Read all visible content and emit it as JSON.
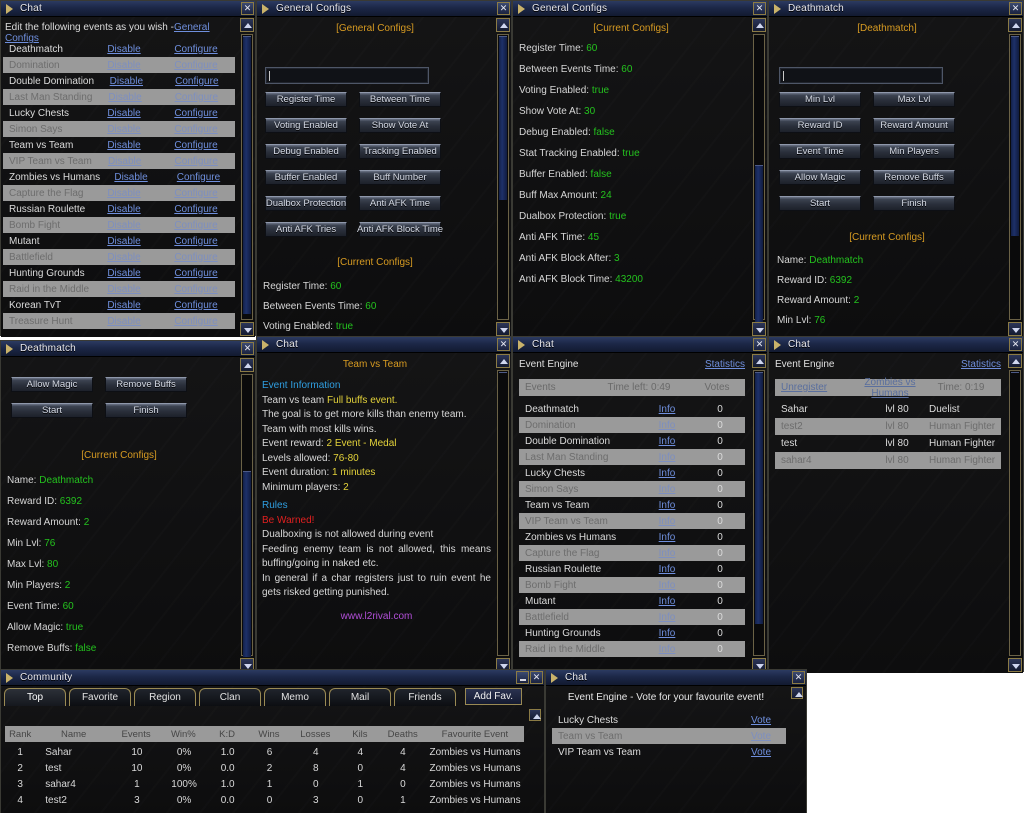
{
  "windows": {
    "events_list": {
      "title": "Chat",
      "intro_text": "Edit the following events as you wish -",
      "intro_link": "General Configs",
      "disable_label": "Disable",
      "configure_label": "Configure",
      "rows": [
        {
          "name": "Deathmatch"
        },
        {
          "name": "Domination"
        },
        {
          "name": "Double Domination"
        },
        {
          "name": "Last Man Standing"
        },
        {
          "name": "Lucky Chests"
        },
        {
          "name": "Simon Says"
        },
        {
          "name": "Team vs Team"
        },
        {
          "name": "VIP Team vs Team"
        },
        {
          "name": "Zombies vs Humans"
        },
        {
          "name": "Capture the Flag"
        },
        {
          "name": "Russian Roulette"
        },
        {
          "name": "Bomb Fight"
        },
        {
          "name": "Mutant"
        },
        {
          "name": "Battlefield"
        },
        {
          "name": "Hunting Grounds"
        },
        {
          "name": "Raid in the Middle"
        },
        {
          "name": "Korean TvT"
        },
        {
          "name": "Treasure Hunt"
        }
      ]
    },
    "general_configs": {
      "title": "General Configs",
      "heading": "[General Configs]",
      "input_value": "",
      "buttons": [
        "Register Time",
        "Between Time",
        "Voting Enabled",
        "Show Vote At",
        "Debug Enabled",
        "Tracking Enabled",
        "Buffer Enabled",
        "Buff Number",
        "Dualbox Protection",
        "Anti AFK Time",
        "Anti AFK Tries",
        "Anti AFK Block Time"
      ],
      "current_heading": "[Current Configs]",
      "current": [
        {
          "label": "Register Time:",
          "value": "60"
        },
        {
          "label": "Between Events Time:",
          "value": "60"
        },
        {
          "label": "Voting Enabled:",
          "value": "true"
        }
      ]
    },
    "general_configs_current": {
      "title": "General Configs",
      "heading": "[Current Configs]",
      "items": [
        {
          "label": "Register Time:",
          "value": "60"
        },
        {
          "label": "Between Events Time:",
          "value": "60"
        },
        {
          "label": "Voting Enabled:",
          "value": "true"
        },
        {
          "label": "Show Vote At:",
          "value": "30"
        },
        {
          "label": "Debug Enabled:",
          "value": "false"
        },
        {
          "label": "Stat Tracking Enabled:",
          "value": "true"
        },
        {
          "label": "Buffer Enabled:",
          "value": "false"
        },
        {
          "label": "Buff Max Amount:",
          "value": "24"
        },
        {
          "label": "Dualbox Protection:",
          "value": "true"
        },
        {
          "label": "Anti AFK Time:",
          "value": "45"
        },
        {
          "label": "Anti AFK Block After:",
          "value": "3"
        },
        {
          "label": "Anti AFK Block Time:",
          "value": "43200"
        }
      ]
    },
    "deathmatch_config": {
      "title": "Deathmatch",
      "heading": "[Deathmatch]",
      "input_value": "",
      "buttons": [
        "Min Lvl",
        "Max Lvl",
        "Reward ID",
        "Reward Amount",
        "Event Time",
        "Min Players",
        "Allow Magic",
        "Remove Buffs",
        "Start",
        "Finish"
      ],
      "current_heading": "[Current Configs]",
      "current": [
        {
          "label": "Name:",
          "value": "Deathmatch"
        },
        {
          "label": "Reward ID:",
          "value": "6392"
        },
        {
          "label": "Reward Amount:",
          "value": "2"
        },
        {
          "label": "Min Lvl:",
          "value": "76"
        }
      ]
    },
    "deathmatch_details": {
      "title": "Deathmatch",
      "buttons": [
        "Allow Magic",
        "Remove Buffs",
        "Start",
        "Finish"
      ],
      "current_heading": "[Current Configs]",
      "current": [
        {
          "label": "Name:",
          "value": "Deathmatch"
        },
        {
          "label": "Reward ID:",
          "value": "6392"
        },
        {
          "label": "Reward Amount:",
          "value": "2"
        },
        {
          "label": "Min Lvl:",
          "value": "76"
        },
        {
          "label": "Max Lvl:",
          "value": "80"
        },
        {
          "label": "Min Players:",
          "value": "2"
        },
        {
          "label": "Event Time:",
          "value": "60"
        },
        {
          "label": "Allow Magic:",
          "value": "true"
        },
        {
          "label": "Remove Buffs:",
          "value": "false"
        }
      ]
    },
    "team_vs_team_info": {
      "title": "Chat",
      "heading": "Team vs Team",
      "section_info": "Event Information",
      "line_1_pre": "Team vs team ",
      "line_1_hi": "Full buffs event.",
      "line_2": "The goal is to get more kills than enemy team.",
      "line_3": "Team with most kills wins.",
      "reward_label": "Event reward: ",
      "reward_value": "2 Event - Medal",
      "levels_label": "Levels allowed: ",
      "levels_value": "76-80",
      "duration_label": "Event duration: ",
      "duration_value": "1 minutes",
      "minplayers_label": "Minimum players: ",
      "minplayers_value": "2",
      "section_rules": "Rules",
      "warning": "Be Warned!",
      "rule_1": "Dualboxing is not allowed during event",
      "rule_2": "Feeding enemy team is not allowed, this means buffing/going in naked etc.",
      "rule_3": "In general if a char registers just to ruin event he gets risked getting punished.",
      "website": "www.l2rival.com"
    },
    "event_engine_vote": {
      "title": "Chat",
      "header": "Event Engine",
      "statistics_link": "Statistics",
      "col_events": "Events",
      "col_time": "Time left: 0:49",
      "col_votes": "Votes",
      "info_label": "Info",
      "rows": [
        {
          "name": "Deathmatch",
          "votes": "0"
        },
        {
          "name": "Domination",
          "votes": "0"
        },
        {
          "name": "Double Domination",
          "votes": "0"
        },
        {
          "name": "Last Man Standing",
          "votes": "0"
        },
        {
          "name": "Lucky Chests",
          "votes": "0"
        },
        {
          "name": "Simon Says",
          "votes": "0"
        },
        {
          "name": "Team vs Team",
          "votes": "0"
        },
        {
          "name": "VIP Team vs Team",
          "votes": "0"
        },
        {
          "name": "Zombies vs Humans",
          "votes": "0"
        },
        {
          "name": "Capture the Flag",
          "votes": "0"
        },
        {
          "name": "Russian Roulette",
          "votes": "0"
        },
        {
          "name": "Bomb Fight",
          "votes": "0"
        },
        {
          "name": "Mutant",
          "votes": "0"
        },
        {
          "name": "Battlefield",
          "votes": "0"
        },
        {
          "name": "Hunting Grounds",
          "votes": "0"
        },
        {
          "name": "Raid in the Middle",
          "votes": "0"
        }
      ]
    },
    "event_engine_registered": {
      "title": "Chat",
      "header": "Event Engine",
      "statistics_link": "Statistics",
      "unregister_link": "Unregister",
      "event_link": "Zombies vs Humans",
      "time_label": "Time: 0:19",
      "players": [
        {
          "name": "Sahar",
          "level": "lvl 80",
          "class": "Duelist"
        },
        {
          "name": "test2",
          "level": "lvl 80",
          "class": "Human Fighter"
        },
        {
          "name": "test",
          "level": "lvl 80",
          "class": "Human Fighter"
        },
        {
          "name": "sahar4",
          "level": "lvl 80",
          "class": "Human Fighter"
        }
      ]
    },
    "community": {
      "title": "Community",
      "tabs": [
        "Top",
        "Favorite",
        "Region",
        "Clan",
        "Memo",
        "Mail",
        "Friends"
      ],
      "active_tab": "Top",
      "add_fav_label": "Add Fav.",
      "columns": [
        "Rank",
        "Name",
        "Events",
        "Win%",
        "K:D",
        "Wins",
        "Losses",
        "Kils",
        "Deaths",
        "Favourite Event"
      ],
      "rows": [
        {
          "rank": "1",
          "name": "Sahar",
          "events": "10",
          "winpct": "0%",
          "kd": "1.0",
          "wins": "6",
          "losses": "4",
          "kills": "4",
          "deaths": "4",
          "fav": "Zombies vs Humans"
        },
        {
          "rank": "2",
          "name": "test",
          "events": "10",
          "winpct": "0%",
          "kd": "0.0",
          "wins": "2",
          "losses": "8",
          "kills": "0",
          "deaths": "4",
          "fav": "Zombies vs Humans"
        },
        {
          "rank": "3",
          "name": "sahar4",
          "events": "1",
          "winpct": "100%",
          "kd": "1.0",
          "wins": "1",
          "losses": "0",
          "kills": "1",
          "deaths": "0",
          "fav": "Zombies vs Humans"
        },
        {
          "rank": "4",
          "name": "test2",
          "events": "3",
          "winpct": "0%",
          "kd": "0.0",
          "wins": "0",
          "losses": "3",
          "kills": "0",
          "deaths": "1",
          "fav": "Zombies vs Humans"
        }
      ]
    },
    "vote_panel": {
      "title": "Chat",
      "heading": "Event Engine - Vote for your favourite event!",
      "vote_label": "Vote",
      "rows": [
        {
          "name": "Lucky Chests"
        },
        {
          "name": "Team vs Team"
        },
        {
          "name": "VIP Team vs Team"
        }
      ]
    }
  },
  "icons": {
    "close": "✕",
    "minimize": "–"
  },
  "colors": {
    "accent_orange": "#d79b22",
    "value_green": "#24c21e",
    "link_blue": "#6f8fdd",
    "warning_red": "#e02020",
    "website_purple": "#b24fd8",
    "section_blue": "#2f9ee0",
    "highlight_yellow": "#e3d23a"
  }
}
